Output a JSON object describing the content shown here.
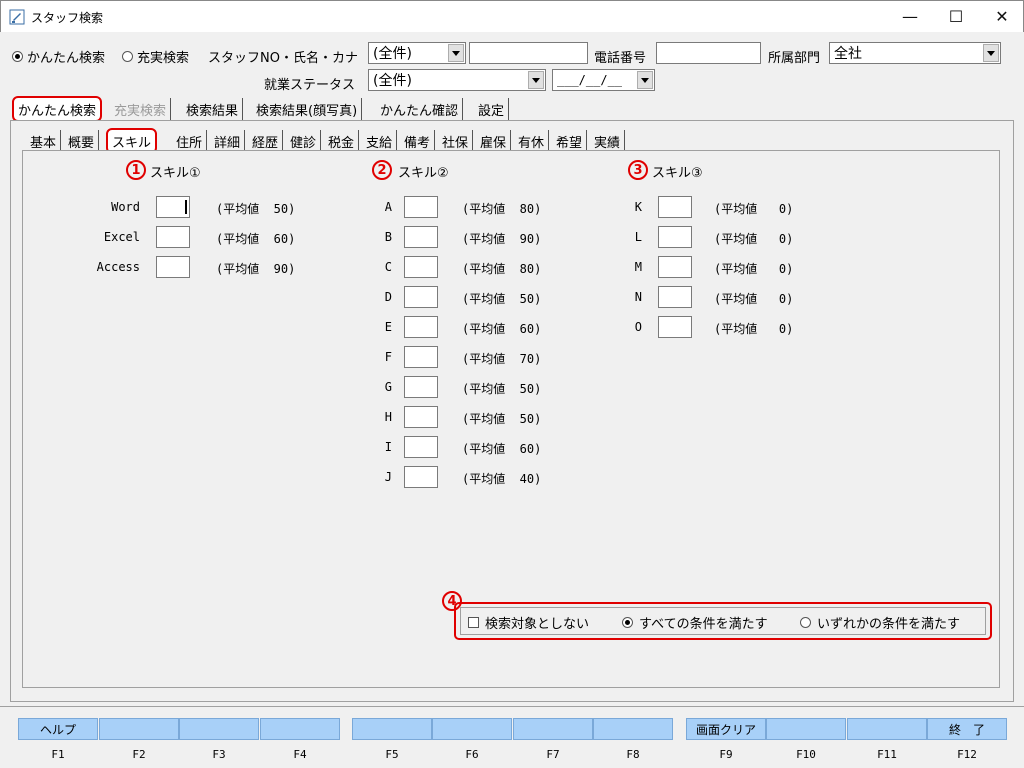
{
  "window": {
    "title": "スタッフ検索",
    "controls": {
      "minimize": "—",
      "maximize": "☐",
      "close": "✕"
    }
  },
  "search": {
    "mode_simple": "かんたん検索",
    "mode_full": "充実検索",
    "mode_selected": "simple",
    "staff_label": "スタッフNO・氏名・カナ",
    "staff_combo_value": "(全件)",
    "staff_text_value": "",
    "phone_label": "電話番号",
    "phone_value": "",
    "dept_label": "所属部門",
    "dept_value": "全社",
    "status_label": "就業ステータス",
    "status_value": "(全件)",
    "date_value": "___/__/__"
  },
  "main_tabs": [
    {
      "label": "かんたん検索"
    },
    {
      "label": "充実検索"
    },
    {
      "label": "検索結果"
    },
    {
      "label": "検索結果(顔写真)"
    },
    {
      "label": "かんたん確認"
    },
    {
      "label": "設定"
    }
  ],
  "sub_tabs": [
    {
      "label": "基本"
    },
    {
      "label": "概要"
    },
    {
      "label": "スキル"
    },
    {
      "label": "住所"
    },
    {
      "label": "詳細"
    },
    {
      "label": "経歴"
    },
    {
      "label": "健診"
    },
    {
      "label": "税金"
    },
    {
      "label": "支給"
    },
    {
      "label": "備考"
    },
    {
      "label": "社保"
    },
    {
      "label": "雇保"
    },
    {
      "label": "有休"
    },
    {
      "label": "希望"
    },
    {
      "label": "実績"
    }
  ],
  "skill_groups": [
    {
      "badge": "1",
      "title": "スキル①",
      "items": [
        {
          "name": "Word",
          "avg": "(平均値  50)"
        },
        {
          "name": "Excel",
          "avg": "(平均値  60)"
        },
        {
          "name": "Access",
          "avg": "(平均値  90)"
        }
      ]
    },
    {
      "badge": "2",
      "title": "スキル②",
      "items": [
        {
          "name": "A",
          "avg": "(平均値  80)"
        },
        {
          "name": "B",
          "avg": "(平均値  90)"
        },
        {
          "name": "C",
          "avg": "(平均値  80)"
        },
        {
          "name": "D",
          "avg": "(平均値  50)"
        },
        {
          "name": "E",
          "avg": "(平均値  60)"
        },
        {
          "name": "F",
          "avg": "(平均値  70)"
        },
        {
          "name": "G",
          "avg": "(平均値  50)"
        },
        {
          "name": "H",
          "avg": "(平均値  50)"
        },
        {
          "name": "I",
          "avg": "(平均値  60)"
        },
        {
          "name": "J",
          "avg": "(平均値  40)"
        }
      ]
    },
    {
      "badge": "3",
      "title": "スキル③",
      "items": [
        {
          "name": "K",
          "avg": "(平均値   0)"
        },
        {
          "name": "L",
          "avg": "(平均値   0)"
        },
        {
          "name": "M",
          "avg": "(平均値   0)"
        },
        {
          "name": "N",
          "avg": "(平均値   0)"
        },
        {
          "name": "O",
          "avg": "(平均値   0)"
        }
      ]
    }
  ],
  "conditions": {
    "badge": "4",
    "exclude_label": "検索対象としない",
    "all_label": "すべての条件を満たす",
    "any_label": "いずれかの条件を満たす",
    "selected": "all"
  },
  "fkeys": [
    {
      "key": "F1",
      "label": "ヘルプ"
    },
    {
      "key": "F2",
      "label": ""
    },
    {
      "key": "F3",
      "label": ""
    },
    {
      "key": "F4",
      "label": ""
    },
    {
      "key": "F5",
      "label": ""
    },
    {
      "key": "F6",
      "label": ""
    },
    {
      "key": "F7",
      "label": ""
    },
    {
      "key": "F8",
      "label": ""
    },
    {
      "key": "F9",
      "label": "画面クリア"
    },
    {
      "key": "F10",
      "label": ""
    },
    {
      "key": "F11",
      "label": ""
    },
    {
      "key": "F12",
      "label": "終　了"
    }
  ],
  "colors": {
    "highlight": "#e00000",
    "fkey": "#a8d0f8"
  }
}
